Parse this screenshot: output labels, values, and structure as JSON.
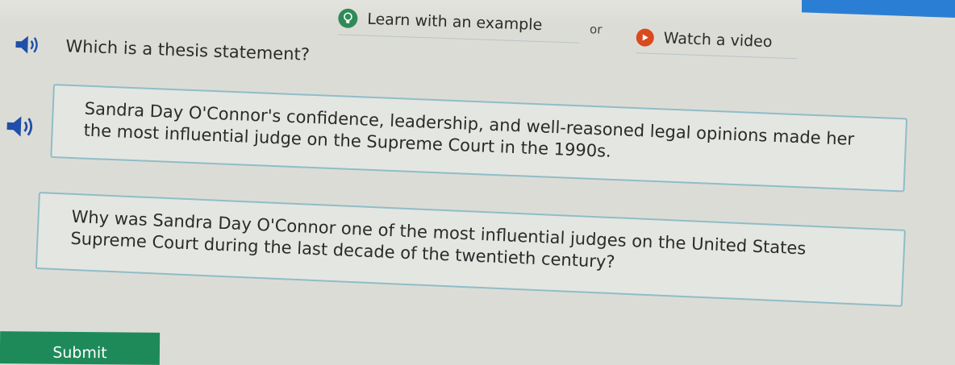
{
  "helpers": {
    "learn_label": "Learn with an example",
    "or_label": "or",
    "video_label": "Watch a video"
  },
  "question": {
    "text": "Which is a thesis statement?"
  },
  "options": [
    {
      "text": "Sandra Day O'Connor's confidence, leadership, and well-reasoned legal opinions made her the most influential judge on the Supreme Court in the 1990s."
    },
    {
      "text": "Why was Sandra Day O'Connor one of the most influential judges on the United States Supreme Court during the last decade of the twentieth century?"
    }
  ],
  "submit_label": "Submit",
  "colors": {
    "background": "#dcdcd6",
    "option_border": "#8fbdc6",
    "submit_green": "#1e8a5a",
    "speaker_blue": "#1f4fa8",
    "bulb_green": "#2e8b57",
    "play_orange": "#d94a1e",
    "accent_blue": "#2a7fd4"
  },
  "icons": {
    "learn": "lightbulb-icon",
    "video": "play-icon",
    "audio": "speaker-icon"
  }
}
